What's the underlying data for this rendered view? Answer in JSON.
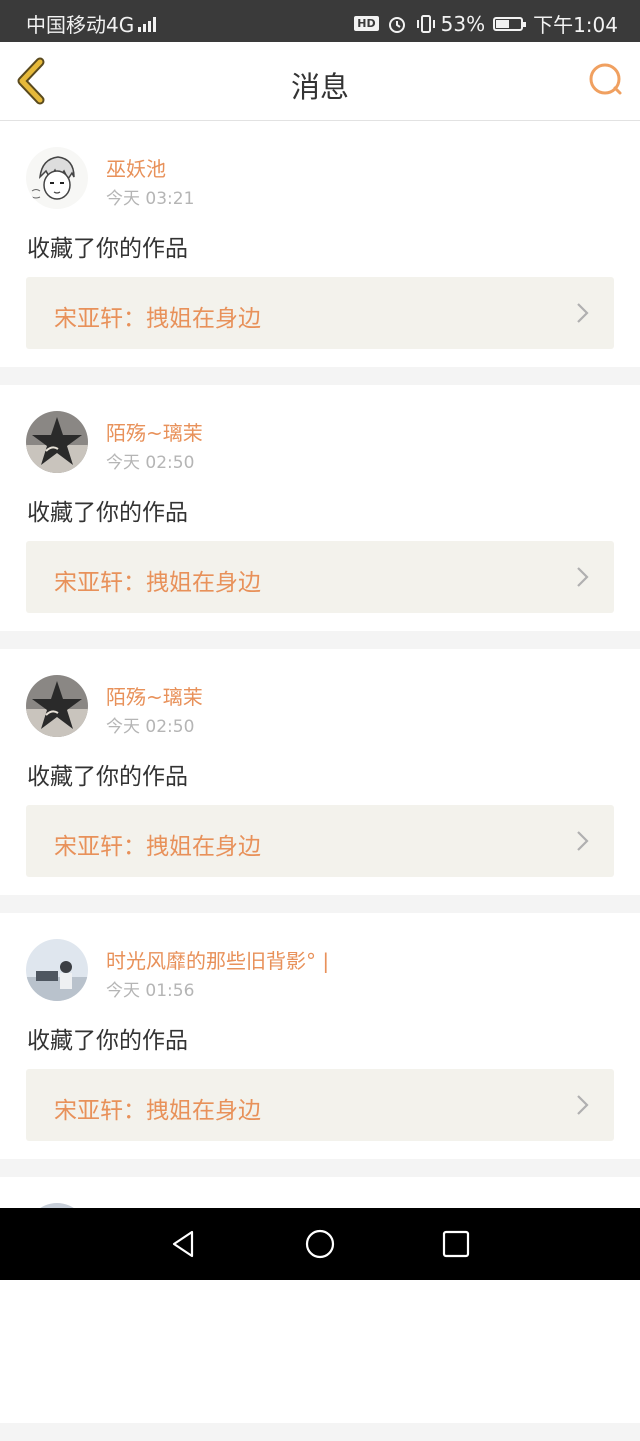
{
  "status_bar": {
    "carrier": "中国移动4G",
    "battery_percent": "53%",
    "battery_level": 0.53,
    "time": "下午1:04",
    "hd_badge": "HD"
  },
  "header": {
    "title": "消息",
    "back_icon": "chevron-left-icon",
    "search_icon": "search-icon"
  },
  "colors": {
    "accent": "#e8915a",
    "link_bg": "#f3f2ec",
    "back_icon": "#e6b93a"
  },
  "messages": [
    {
      "username": "巫妖池",
      "time": "今天 03:21",
      "action": "收藏了你的作品",
      "work_title": "宋亚轩：拽姐在身边",
      "avatar": "anime-sketch-avatar"
    },
    {
      "username": "陌殇~璃茉",
      "time": "今天 02:50",
      "action": "收藏了你的作品",
      "work_title": "宋亚轩：拽姐在身边",
      "avatar": "dark-star-avatar"
    },
    {
      "username": "陌殇~璃茉",
      "time": "今天 02:50",
      "action": "收藏了你的作品",
      "work_title": "宋亚轩：拽姐在身边",
      "avatar": "dark-star-avatar"
    },
    {
      "username": "时光风靡的那些旧背影° |",
      "time": "今天 01:56",
      "action": "收藏了你的作品",
      "work_title": "宋亚轩：拽姐在身边",
      "avatar": "sky-photo-avatar"
    }
  ]
}
